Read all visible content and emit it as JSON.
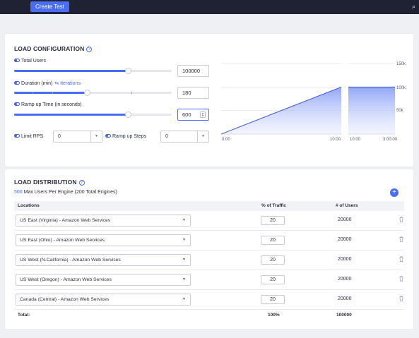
{
  "topbar": {
    "create_test_label": "Create Test"
  },
  "load_config": {
    "title": "LOAD CONFIGURATION",
    "help": "?",
    "total_users": {
      "label": "Total Users",
      "value": "100000",
      "slider_fraction": 0.72
    },
    "duration": {
      "label": "Duration (min)",
      "alt_label": "⇆ Iterations",
      "value": "180",
      "slider_fraction": 0.46
    },
    "ramp_up": {
      "label": "Ramp up Time (in seconds)",
      "value": "600",
      "slider_fraction": 0.72
    },
    "limit_rps": {
      "label": "Limit RPS",
      "value": "0"
    },
    "ramp_steps": {
      "label": "Ramp up Steps",
      "value": "0"
    },
    "chart": {
      "y_ticks": [
        "150k",
        "100k",
        "50k"
      ],
      "x_labels_left": [
        "0:00",
        "10:00"
      ],
      "x_labels_right": [
        "10:00",
        "3:00:00"
      ]
    }
  },
  "chart_data": {
    "type": "area",
    "title": "",
    "xlabel": "",
    "ylabel": "",
    "y_ticks": [
      "150k",
      "100k",
      "50k"
    ],
    "ylim": [
      0,
      150000
    ],
    "series": [
      {
        "x": [
          "0:00",
          "10:00"
        ],
        "values": [
          0,
          100000
        ]
      },
      {
        "x": [
          "10:00",
          "3:00:00"
        ],
        "values": [
          100000,
          100000
        ]
      }
    ],
    "grid": true,
    "color": "#4a6cf7"
  },
  "load_dist": {
    "title": "LOAD DISTRIBUTION",
    "help": "?",
    "max_users_num": "500",
    "max_users_text": "Max Users Per Engine (200 Total Engines)",
    "add": "+",
    "headers": {
      "locations": "Locations",
      "traffic": "% of Traffic",
      "users": "# of Users"
    },
    "rows": [
      {
        "location": "US East (Virginia) - Amazon Web Services",
        "traffic": "20",
        "users": "20000"
      },
      {
        "location": "US East (Ohio) - Amazon Web Services",
        "traffic": "20",
        "users": "20000"
      },
      {
        "location": "US West (N.California) - Amazon Web Services",
        "traffic": "20",
        "users": "20000"
      },
      {
        "location": "US West (Oregon) - Amazon Web Services",
        "traffic": "20",
        "users": "20000"
      },
      {
        "location": "Canada (Central) - Amazon Web Services",
        "traffic": "20",
        "users": "20000"
      }
    ],
    "total": {
      "label": "Total:",
      "traffic": "100%",
      "users": "100000"
    }
  },
  "colors": {
    "accent": "#4a6cf7",
    "topbar": "#1f2233",
    "page_bg": "#eef0f4"
  },
  "icons": {
    "help": "help-circle-icon",
    "toggle": "toggle-icon",
    "delete": "trash-icon",
    "dropdown": "chevron-down-icon",
    "add": "plus-icon",
    "search": "search-icon"
  }
}
